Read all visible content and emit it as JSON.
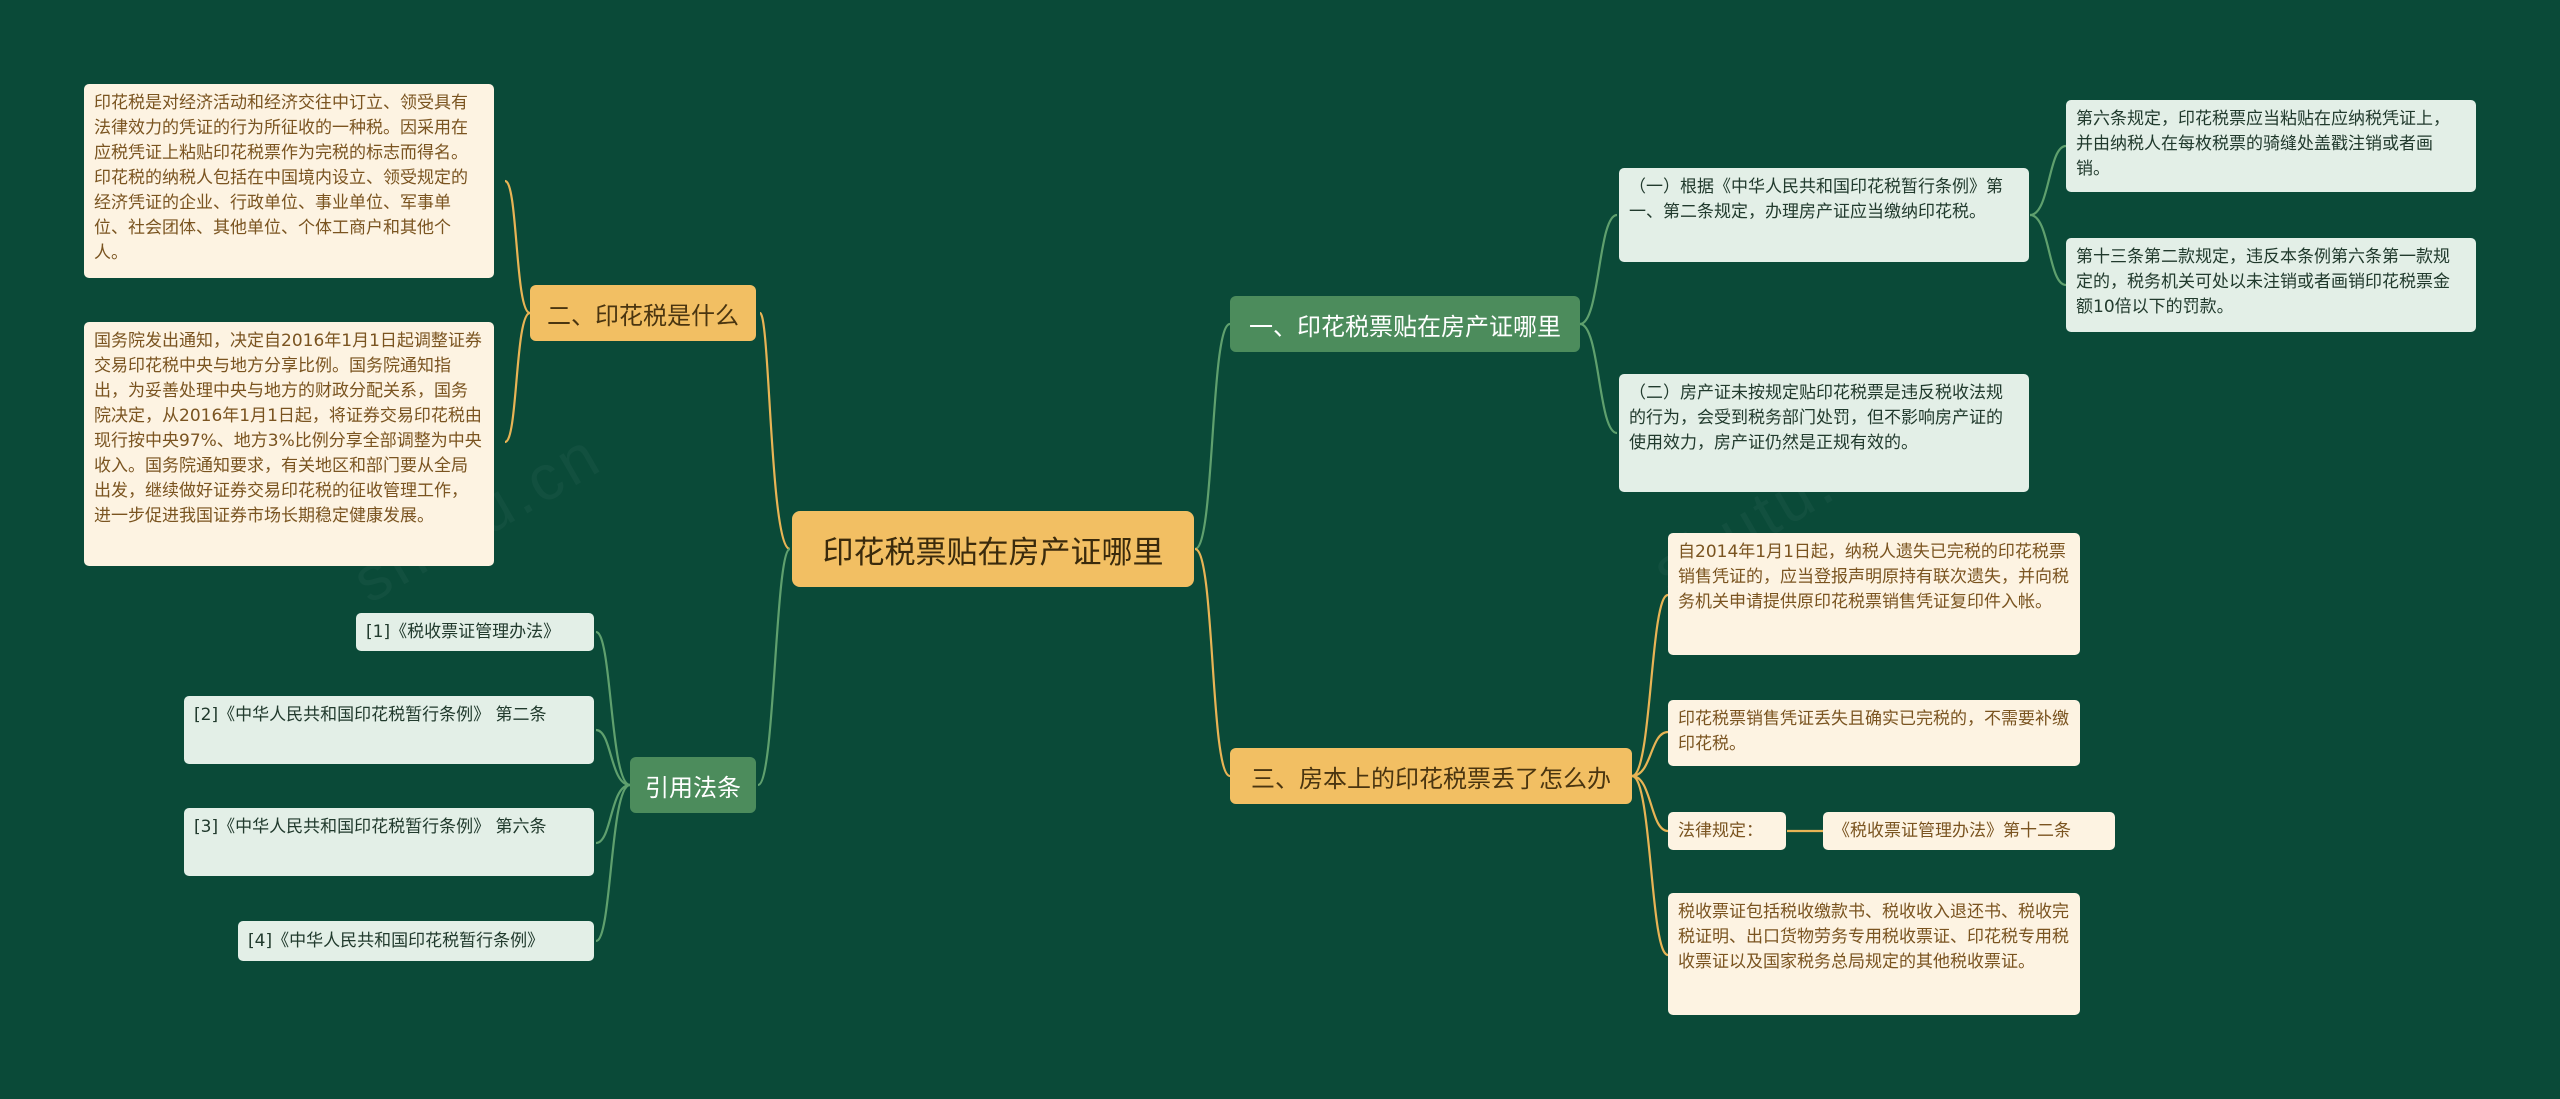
{
  "root": {
    "label": "印花税票贴在房产证哪里"
  },
  "left": {
    "what_is": {
      "label": "二、印花税是什么",
      "details": [
        "印花税是对经济活动和经济交往中订立、领受具有法律效力的凭证的行为所征收的一种税。因采用在应税凭证上粘贴印花税票作为完税的标志而得名。印花税的纳税人包括在中国境内设立、领受规定的经济凭证的企业、行政单位、事业单位、军事单位、社会团体、其他单位、个体工商户和其他个人。",
        "国务院发出通知，决定自2016年1月1日起调整证券交易印花税中央与地方分享比例。国务院通知指出，为妥善处理中央与地方的财政分配关系，国务院决定，从2016年1月1日起，将证券交易印花税由现行按中央97%、地方3%比例分享全部调整为中央收入。国务院通知要求，有关地区和部门要从全局出发，继续做好证券交易印花税的征收管理工作，进一步促进我国证券市场长期稳定健康发展。"
      ]
    },
    "references": {
      "label": "引用法条",
      "items": [
        "[1]《税收票证管理办法》",
        "[2]《中华人民共和国印花税暂行条例》 第二条",
        "[3]《中华人民共和国印花税暂行条例》 第六条",
        "[4]《中华人民共和国印花税暂行条例》"
      ]
    }
  },
  "right": {
    "where": {
      "label": "一、印花税票贴在房产证哪里",
      "item1": "（一）根据《中华人民共和国印花税暂行条例》第一、第二条规定，办理房产证应当缴纳印花税。",
      "item1_subs": [
        "第六条规定，印花税票应当粘贴在应纳税凭证上，并由纳税人在每枚税票的骑缝处盖戳注销或者画销。",
        "第十三条第二款规定，违反本条例第六条第一款规定的，税务机关可处以未注销或者画销印花税票金额10倍以下的罚款。"
      ],
      "item2": "（二）房产证未按规定贴印花税票是违反税收法规的行为，会受到税务部门处罚，但不影响房产证的使用效力，房产证仍然是正规有效的。"
    },
    "lost": {
      "label": "三、房本上的印花税票丢了怎么办",
      "items": [
        "自2014年1月1日起，纳税人遗失已完税的印花税票销售凭证的，应当登报声明原持有联次遗失，并向税务机关申请提供原印花税票销售凭证复印件入帐。",
        "印花税票销售凭证丢失且确实已完税的，不需要补缴印花税。"
      ],
      "law_label": "法律规定：",
      "law_ref": "《税收票证管理办法》第十二条",
      "last": "税收票证包括税收缴款书、税收收入退还书、税收完税证明、出口货物劳务专用税收票证、印花税专用税收票证以及国家税务总局规定的其他税收票证。"
    }
  },
  "colors": {
    "background": "#0a4a38",
    "yellow": "#f2bf63",
    "green": "#4c8c5c",
    "leaf_yellow_bg": "#fdf3e2",
    "leaf_green_bg": "#e3efe7",
    "line_yellow": "#e8b455",
    "line_green": "#5fa06e"
  }
}
